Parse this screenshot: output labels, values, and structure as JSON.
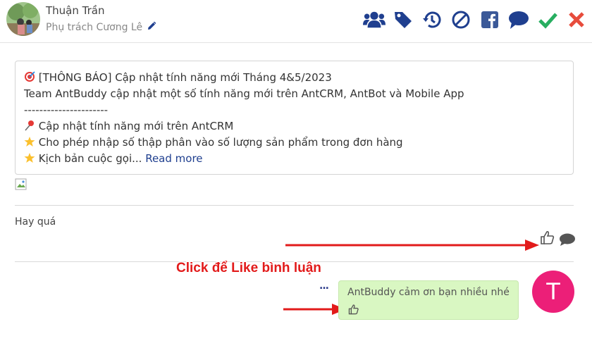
{
  "header": {
    "user_name": "Thuận Trần",
    "assignee": "Phụ trách Cương Lê",
    "icons": [
      "users-icon",
      "tag-icon",
      "history-icon",
      "block-icon",
      "facebook-icon",
      "chat-icon",
      "check-icon",
      "close-icon"
    ],
    "colors": {
      "icon_blue": "#1f3f8f",
      "facebook": "#3b5998",
      "check": "#27ae60",
      "close": "#e74c3c"
    }
  },
  "post": {
    "lines": [
      "[THÔNG BÁO] Cập nhật tính năng mới Tháng 4&5/2023",
      "Team AntBuddy cập nhật một số tính năng mới trên AntCRM, AntBot và Mobile App",
      "----------------------",
      "Cập nhật tính năng mới trên AntCRM",
      "Cho phép nhập số thập phân vào số lượng sản phẩm trong đơn hàng",
      "Kịch bản cuộc gọi..."
    ],
    "read_more": "Read more"
  },
  "comment": {
    "text": "Hay quá"
  },
  "annotation": {
    "text": "Click để Like bình luận",
    "color": "#e21b1b"
  },
  "reply": {
    "more": "...",
    "text": "AntBuddy cảm ơn bạn nhiều nhé",
    "avatar_letter": "T",
    "avatar_color": "#ec1f78",
    "bubble_color": "#d9f7c2"
  }
}
